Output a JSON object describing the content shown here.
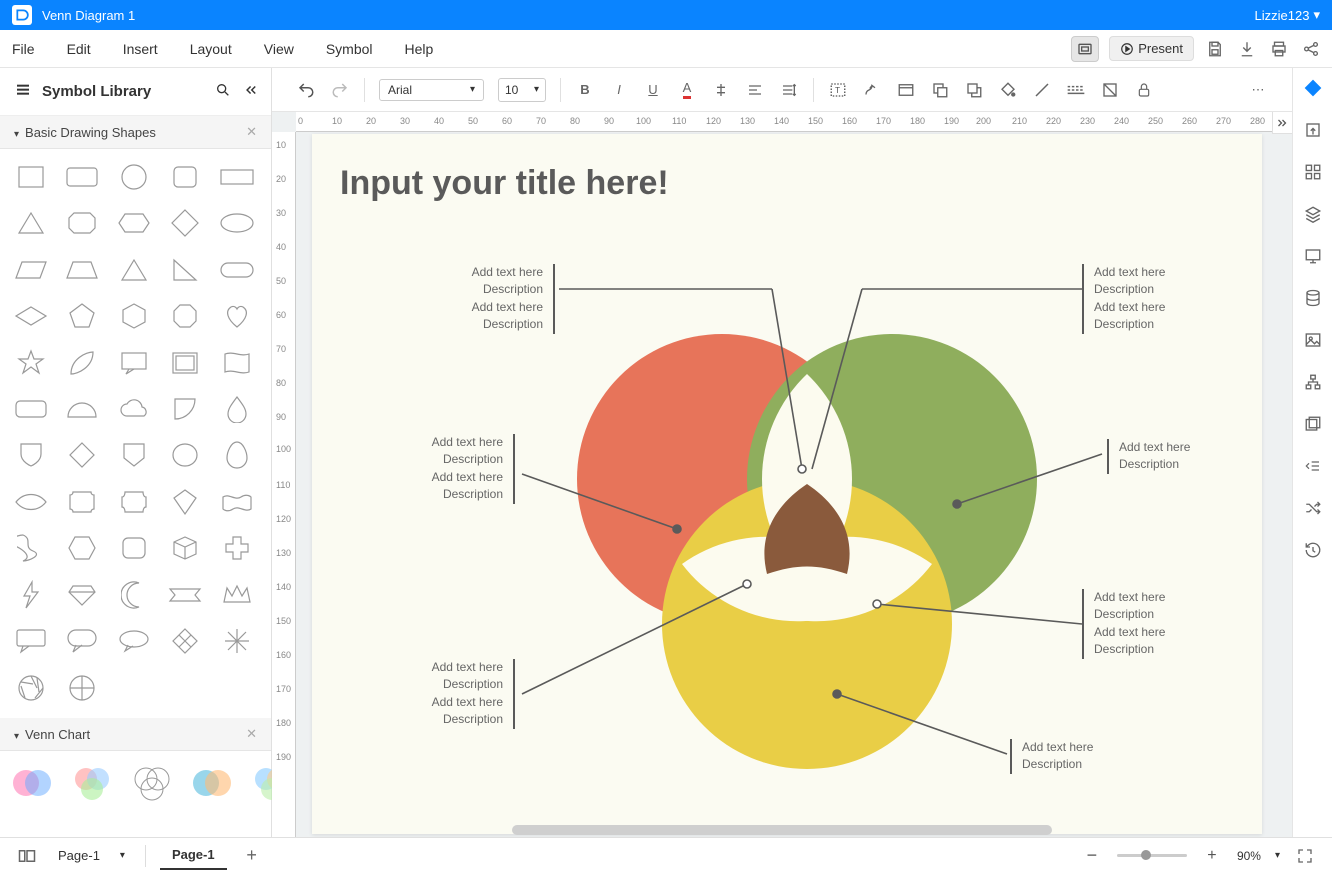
{
  "titlebar": {
    "doc_title": "Venn Diagram 1",
    "user": "Lizzie123"
  },
  "menubar": {
    "items": [
      "File",
      "Edit",
      "Insert",
      "Layout",
      "View",
      "Symbol",
      "Help"
    ],
    "present": "Present"
  },
  "library": {
    "title": "Symbol Library",
    "sections": {
      "basic": "Basic Drawing Shapes",
      "venn": "Venn Chart"
    }
  },
  "toolbar": {
    "font": "Arial",
    "size": "10"
  },
  "canvas": {
    "title": "Input your title here!",
    "labels": {
      "l1": "Add text here\nDescription\nAdd text here\nDescription",
      "l2": "Add text here\nDescription\nAdd text here\nDescription",
      "l3": "Add text here\nDescription\nAdd text here\nDescription",
      "r1": "Add text here\nDescription\nAdd text here\nDescription",
      "r2": "Add text here\nDescription",
      "r3": "Add text here\nDescription\nAdd text here\nDescription",
      "r4": "Add text here\nDescription"
    }
  },
  "bottom": {
    "page_sel": "Page-1",
    "page_tab": "Page-1",
    "zoom": "90%"
  }
}
